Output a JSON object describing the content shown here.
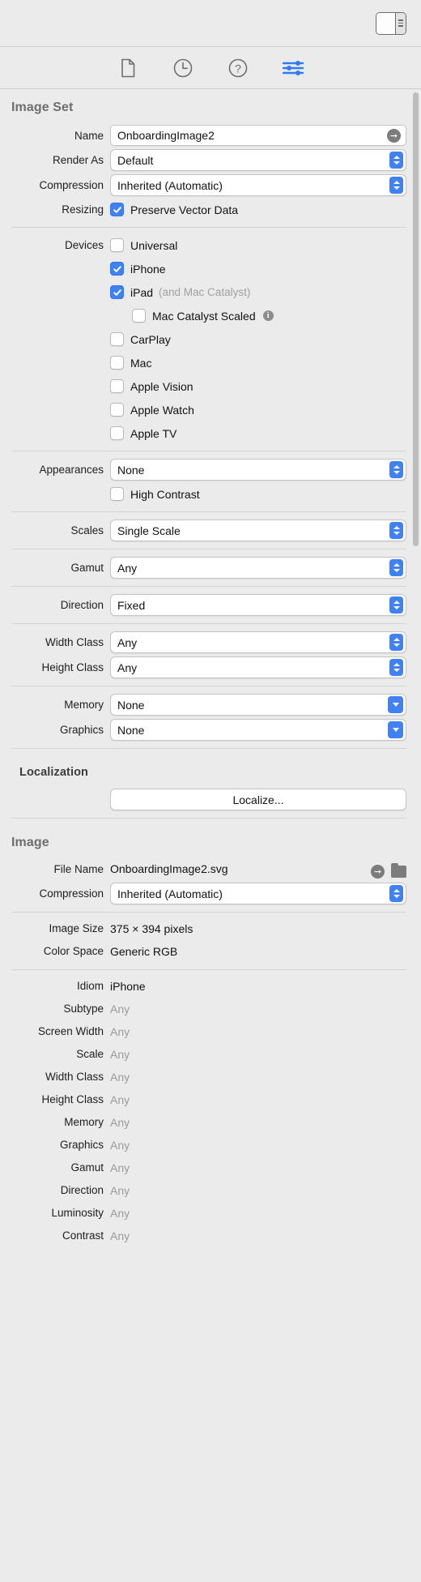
{
  "window": {
    "pane_toggle_name": "inspector-pane-toggle"
  },
  "tabbar": {
    "tabs": [
      {
        "name": "file-inspector-tab",
        "icon": "document-icon",
        "selected": false
      },
      {
        "name": "history-inspector-tab",
        "icon": "clock-icon",
        "selected": false
      },
      {
        "name": "quick-help-inspector-tab",
        "icon": "question-circle-icon",
        "selected": false
      },
      {
        "name": "attributes-inspector-tab",
        "icon": "sliders-icon",
        "selected": true
      }
    ],
    "accent": "#2f7cf6"
  },
  "image_set": {
    "title": "Image Set",
    "name": {
      "label": "Name",
      "value": "OnboardingImage2"
    },
    "render_as": {
      "label": "Render As",
      "value": "Default"
    },
    "compression": {
      "label": "Compression",
      "value": "Inherited (Automatic)"
    },
    "resizing": {
      "label": "Resizing",
      "option": "Preserve Vector Data",
      "checked": true
    },
    "devices": {
      "label": "Devices",
      "items": [
        {
          "label": "Universal",
          "checked": false,
          "indent": false,
          "note": "",
          "info": false
        },
        {
          "label": "iPhone",
          "checked": true,
          "indent": false,
          "note": "",
          "info": false
        },
        {
          "label": "iPad",
          "checked": true,
          "indent": false,
          "note": "(and Mac Catalyst)",
          "info": false
        },
        {
          "label": "Mac Catalyst Scaled",
          "checked": false,
          "indent": true,
          "note": "",
          "info": true
        },
        {
          "label": "CarPlay",
          "checked": false,
          "indent": false,
          "note": "",
          "info": false
        },
        {
          "label": "Mac",
          "checked": false,
          "indent": false,
          "note": "",
          "info": false
        },
        {
          "label": "Apple Vision",
          "checked": false,
          "indent": false,
          "note": "",
          "info": false
        },
        {
          "label": "Apple Watch",
          "checked": false,
          "indent": false,
          "note": "",
          "info": false
        },
        {
          "label": "Apple TV",
          "checked": false,
          "indent": false,
          "note": "",
          "info": false
        }
      ]
    },
    "appearances": {
      "label": "Appearances",
      "value": "None"
    },
    "high_contrast": {
      "option": "High Contrast",
      "checked": false
    },
    "scales": {
      "label": "Scales",
      "value": "Single Scale"
    },
    "gamut": {
      "label": "Gamut",
      "value": "Any"
    },
    "direction": {
      "label": "Direction",
      "value": "Fixed"
    },
    "width_class": {
      "label": "Width Class",
      "value": "Any"
    },
    "height_class": {
      "label": "Height Class",
      "value": "Any"
    },
    "memory": {
      "label": "Memory",
      "value": "None"
    },
    "graphics": {
      "label": "Graphics",
      "value": "None"
    }
  },
  "localization": {
    "title": "Localization",
    "button": "Localize..."
  },
  "image": {
    "title": "Image",
    "file_name": {
      "label": "File Name",
      "value": "OnboardingImage2.svg"
    },
    "compression": {
      "label": "Compression",
      "value": "Inherited (Automatic)"
    },
    "image_size": {
      "label": "Image Size",
      "value": "375 × 394 pixels"
    },
    "color_space": {
      "label": "Color Space",
      "value": "Generic RGB"
    },
    "attributes": [
      {
        "label": "Idiom",
        "value": "iPhone",
        "dim": false
      },
      {
        "label": "Subtype",
        "value": "Any",
        "dim": true
      },
      {
        "label": "Screen Width",
        "value": "Any",
        "dim": true
      },
      {
        "label": "Scale",
        "value": "Any",
        "dim": true
      },
      {
        "label": "Width Class",
        "value": "Any",
        "dim": true
      },
      {
        "label": "Height Class",
        "value": "Any",
        "dim": true
      },
      {
        "label": "Memory",
        "value": "Any",
        "dim": true
      },
      {
        "label": "Graphics",
        "value": "Any",
        "dim": true
      },
      {
        "label": "Gamut",
        "value": "Any",
        "dim": true
      },
      {
        "label": "Direction",
        "value": "Any",
        "dim": true
      },
      {
        "label": "Luminosity",
        "value": "Any",
        "dim": true
      },
      {
        "label": "Contrast",
        "value": "Any",
        "dim": true
      }
    ]
  }
}
